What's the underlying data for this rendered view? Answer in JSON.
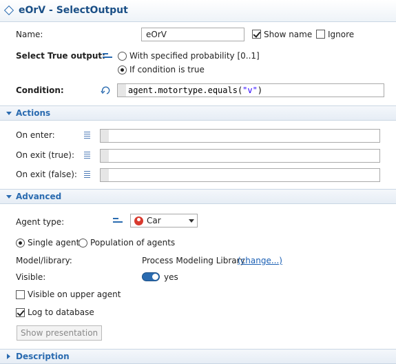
{
  "header": {
    "title": "eOrV - SelectOutput"
  },
  "general": {
    "name_label": "Name:",
    "name_value": "eOrV",
    "show_name_label": "Show name",
    "show_name_checked": true,
    "ignore_label": "Ignore",
    "ignore_checked": false,
    "select_true_output_label": "Select True output:",
    "options": [
      {
        "label": "With specified probability [0..1]",
        "selected": false
      },
      {
        "label": "If condition is true",
        "selected": true
      }
    ],
    "condition_label": "Condition:",
    "condition_code_prefix": "agent.motortype.equals(",
    "condition_code_string": "\"v\"",
    "condition_code_suffix": ")"
  },
  "actions": {
    "title": "Actions",
    "fields": [
      {
        "label": "On enter:",
        "value": ""
      },
      {
        "label": "On exit (true):",
        "value": ""
      },
      {
        "label": "On exit (false):",
        "value": ""
      }
    ]
  },
  "advanced": {
    "title": "Advanced",
    "agent_type_label": "Agent type:",
    "agent_type_value": "Car",
    "agent_mode_options": [
      {
        "label": "Single agent",
        "selected": true
      },
      {
        "label": "Population of agents",
        "selected": false
      }
    ],
    "model_library_label": "Model/library:",
    "model_library_value": "Process Modeling Library",
    "change_link": "(change...)",
    "visible_label": "Visible:",
    "visible_value": "yes",
    "visible_on": true,
    "visible_upper_label": "Visible on upper agent",
    "visible_upper_checked": false,
    "log_db_label": "Log to database",
    "log_db_checked": true,
    "show_presentation_label": "Show presentation"
  },
  "description": {
    "title": "Description"
  },
  "colors": {
    "accent": "#2a6bb0",
    "title": "#1a4f86",
    "link": "#1a5fb4"
  },
  "icons": {
    "element": "diamond-icon",
    "expand": "chevron-down-icon",
    "collapse": "chevron-right-icon",
    "code_field": "lines-icon",
    "static_value": "equals-icon",
    "condition": "dynamic-value-icon",
    "agent": "car-icon"
  }
}
